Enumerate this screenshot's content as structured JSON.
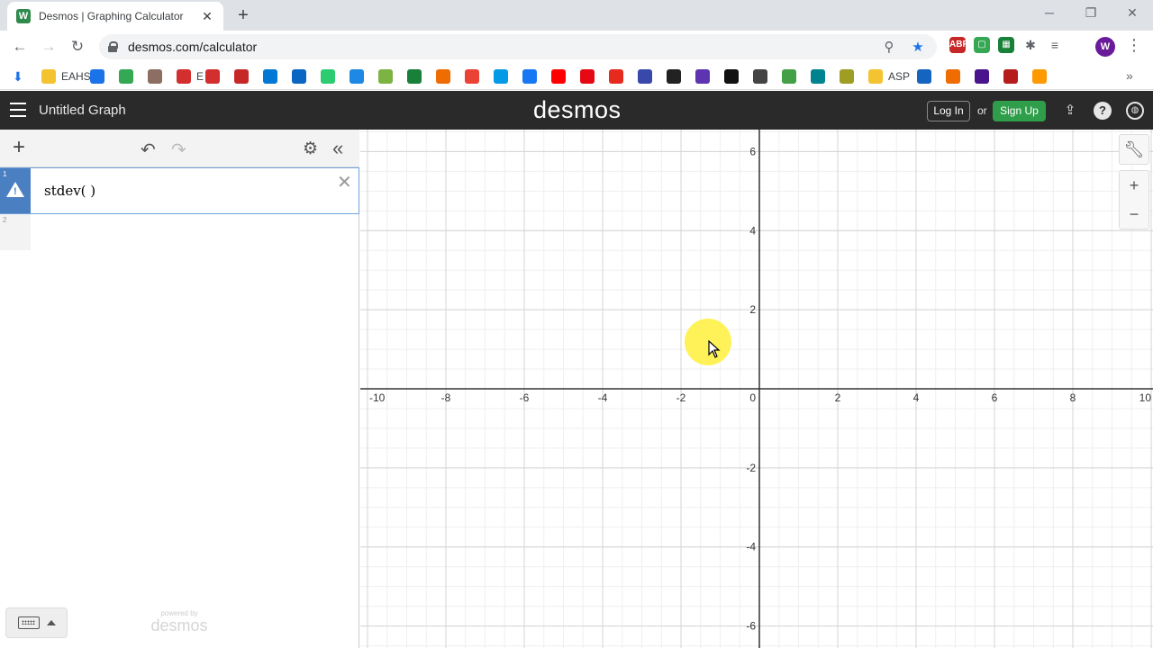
{
  "browser": {
    "tab_title": "Desmos | Graphing Calculator",
    "tab_favicon_letter": "W",
    "url": "desmos.com/calculator",
    "bookmarks": [
      {
        "label": "EAHS",
        "color": "#f4c430"
      },
      {
        "label": "",
        "color": "#1a73e8"
      },
      {
        "label": "",
        "color": "#34a853"
      },
      {
        "label": "",
        "color": "#8d6e63"
      },
      {
        "label": "E",
        "color": "#d32f2f"
      },
      {
        "label": "",
        "color": "#d32f2f"
      },
      {
        "label": "",
        "color": "#c62828"
      },
      {
        "label": "",
        "color": "#0078d4"
      },
      {
        "label": "",
        "color": "#0a66c2"
      },
      {
        "label": "",
        "color": "#2ecc71"
      },
      {
        "label": "",
        "color": "#1e88e5"
      },
      {
        "label": "",
        "color": "#7cb342"
      },
      {
        "label": "",
        "color": "#188038"
      },
      {
        "label": "",
        "color": "#ef6c00"
      },
      {
        "label": "",
        "color": "#ea4335"
      },
      {
        "label": "",
        "color": "#039be5"
      },
      {
        "label": "",
        "color": "#1877f2"
      },
      {
        "label": "",
        "color": "#ff0000"
      },
      {
        "label": "",
        "color": "#e50914"
      },
      {
        "label": "",
        "color": "#e62b1e"
      },
      {
        "label": "",
        "color": "#3949ab"
      },
      {
        "label": "",
        "color": "#222222"
      },
      {
        "label": "",
        "color": "#5e35b1"
      },
      {
        "label": "",
        "color": "#111111"
      },
      {
        "label": "",
        "color": "#444444"
      },
      {
        "label": "",
        "color": "#43a047"
      },
      {
        "label": "",
        "color": "#00838f"
      },
      {
        "label": "",
        "color": "#9e9d24"
      },
      {
        "label": "ASP",
        "color": "#f4c430"
      },
      {
        "label": "",
        "color": "#1565c0"
      },
      {
        "label": "",
        "color": "#ef6c00"
      },
      {
        "label": "",
        "color": "#4a148c"
      },
      {
        "label": "",
        "color": "#b71c1c"
      },
      {
        "label": "",
        "color": "#ff9900"
      }
    ]
  },
  "desmos": {
    "graph_title": "Untitled Graph",
    "logo": "desmos",
    "login_label": "Log In",
    "or_label": "or",
    "signup_label": "Sign Up",
    "expressions": [
      {
        "index": "1",
        "latex": "stdev(  )",
        "warning": true
      },
      {
        "index": "2",
        "latex": "",
        "warning": false
      }
    ],
    "powered_by": "powered by",
    "powered_logo": "desmos",
    "colors": {
      "header_bg": "#2a2a2a",
      "accent_blue": "#4a7fc1",
      "signup_green": "#2f9e4a"
    }
  },
  "axes": {
    "x_min": -10,
    "x_max": 10,
    "y_min": -6.5,
    "y_max": 6.5,
    "x_ticks": [
      -10,
      -8,
      -6,
      -4,
      -2,
      0,
      2,
      4,
      6,
      8,
      10
    ],
    "y_ticks": [
      -6,
      -4,
      -2,
      2,
      4,
      6
    ],
    "grid": true
  }
}
